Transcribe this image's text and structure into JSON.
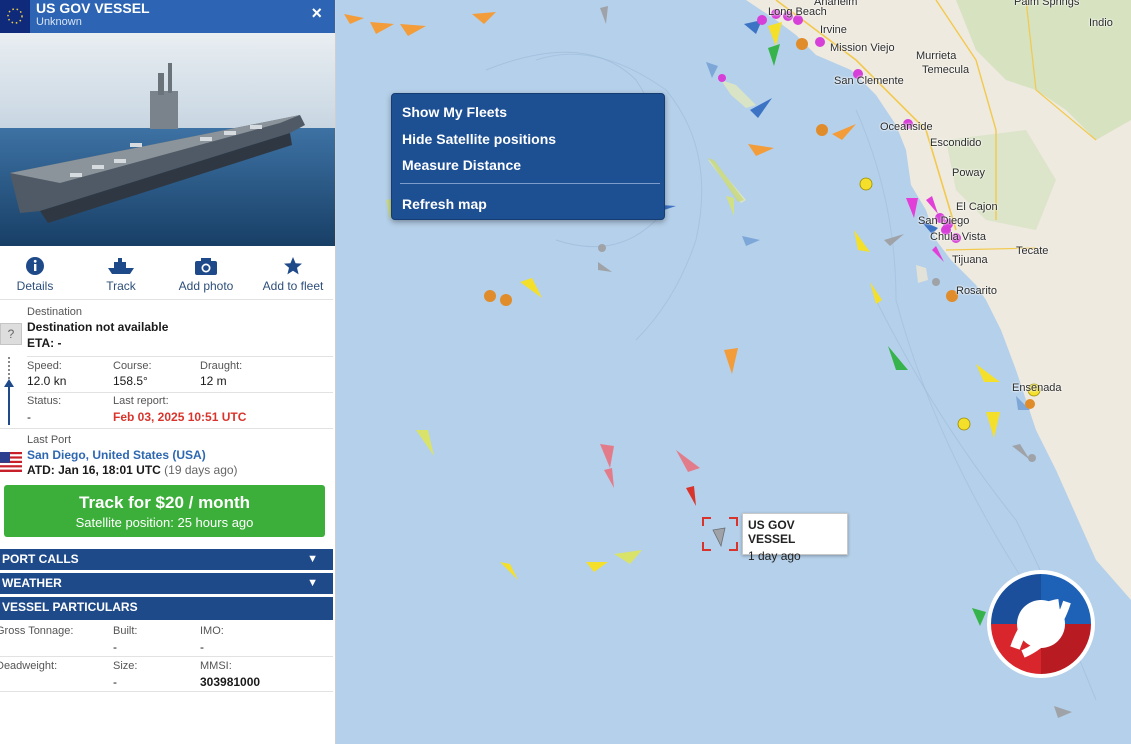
{
  "panel": {
    "vessel_name": "US GOV VESSEL",
    "vessel_type": "Unknown",
    "close_glyph": "×",
    "actions": [
      {
        "label": "Details",
        "icon": "info-icon"
      },
      {
        "label": "Track",
        "icon": "ship-icon"
      },
      {
        "label": "Add photo",
        "icon": "camera-icon"
      },
      {
        "label": "Add to fleet",
        "icon": "star-icon"
      }
    ],
    "destination_label": "Destination",
    "destination_value": "Destination not available",
    "eta": "ETA: -",
    "unknown_port_glyph": "?",
    "speed_label": "Speed:",
    "speed_value": "12.0 kn",
    "course_label": "Course:",
    "course_value": "158.5°",
    "draught_label": "Draught:",
    "draught_value": "12 m",
    "status_label": "Status:",
    "status_value": "-",
    "last_report_label": "Last report:",
    "last_report_value": "Feb 03, 2025 10:51 UTC",
    "last_port_label": "Last Port",
    "last_port_value": "San Diego, United States (USA)",
    "atd_value": "ATD: Jan 16, 18:01 UTC",
    "atd_ago": "(19 days ago)",
    "track_button_main": "Track for $20 / month",
    "track_button_sub": "Satellite position: 25 hours ago",
    "sections": [
      "PORT CALLS",
      "WEATHER",
      "VESSEL PARTICULARS"
    ],
    "particulars": {
      "gross_tonnage_label": "Gross Tonnage:",
      "gross_tonnage_value": "",
      "built_label": "Built:",
      "built_value": "-",
      "imo_label": "IMO:",
      "imo_value": "-",
      "deadweight_label": "Deadweight:",
      "deadweight_value": "",
      "size_label": "Size:",
      "size_value": "-",
      "mmsi_label": "MMSI:",
      "mmsi_value": "303981000"
    }
  },
  "context_menu": {
    "items": [
      "Show My Fleets",
      "Hide Satellite positions",
      "Measure Distance",
      "Refresh map"
    ]
  },
  "vessel_label": {
    "name": "US GOV VESSEL",
    "time": "1 day ago"
  },
  "map_places": [
    "Long Beach",
    "Anaheim",
    "Irvine",
    "Mission Viejo",
    "San Clemente",
    "Oceanside",
    "Murrieta",
    "Temecula",
    "Escondido",
    "Poway",
    "El Cajon",
    "San Diego",
    "Chula Vista",
    "Tijuana",
    "Tecate",
    "Rosarito",
    "Ensenada",
    "Palm Springs",
    "Indio"
  ],
  "colors": {
    "panel_header": "#2d64b3",
    "section_bar": "#1f4a8a",
    "track_button": "#3caf3a",
    "accent_red": "#d9342b",
    "link": "#2e67b1",
    "ocean": "#b5d0ea",
    "land": "#efeadf",
    "context_menu": "#1d4f93"
  }
}
